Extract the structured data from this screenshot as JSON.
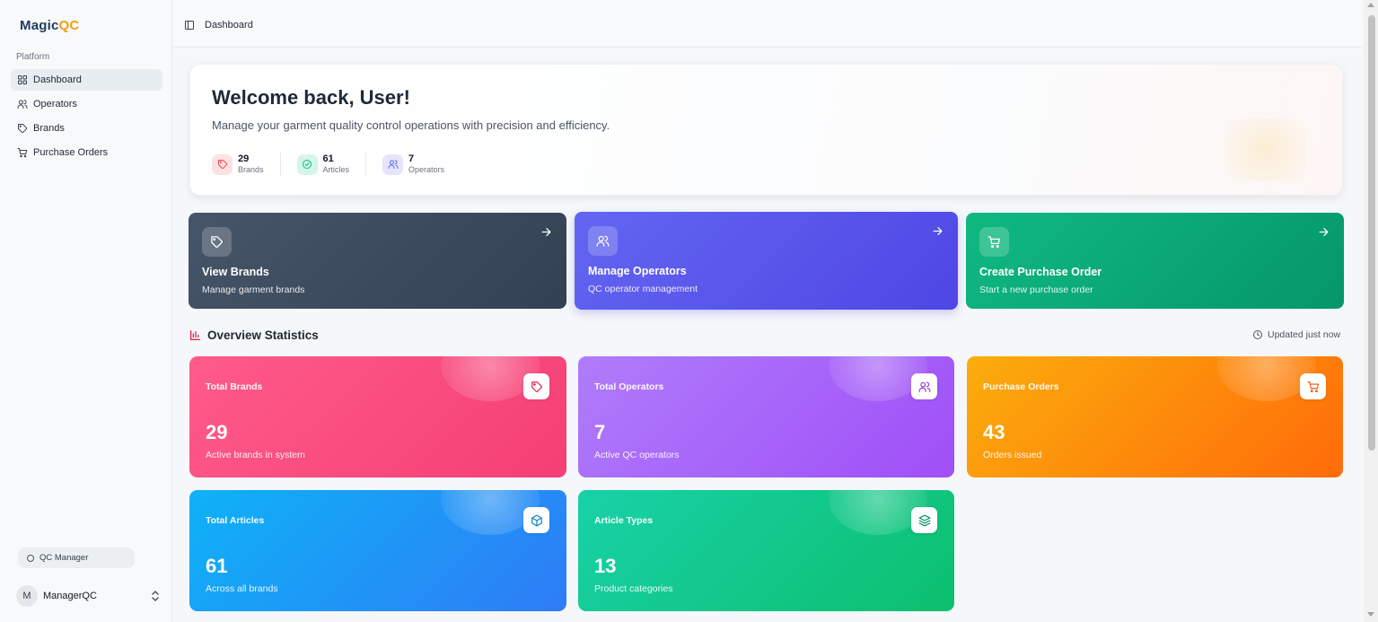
{
  "app": {
    "logo_part1": "Magic",
    "logo_part2": "QC"
  },
  "sidebar": {
    "section_label": "Platform",
    "items": [
      {
        "label": "Dashboard",
        "icon": "grid-icon",
        "active": true
      },
      {
        "label": "Operators",
        "icon": "users-icon"
      },
      {
        "label": "Brands",
        "icon": "tag-icon"
      },
      {
        "label": "Purchase Orders",
        "icon": "cart-icon"
      }
    ],
    "role_badge": "QC Manager",
    "user": {
      "initial": "M",
      "name": "ManagerQC"
    }
  },
  "header": {
    "breadcrumb": "Dashboard"
  },
  "welcome": {
    "title": "Welcome back, User!",
    "subtitle": "Manage your garment quality control operations with precision and efficiency.",
    "stats": [
      {
        "value": "29",
        "label": "Brands",
        "icon": "tag-icon",
        "color": "#ef4444",
        "bg": "#fde2e4"
      },
      {
        "value": "61",
        "label": "Articles",
        "icon": "check-circle-icon",
        "color": "#10b981",
        "bg": "#d6f5e8"
      },
      {
        "value": "7",
        "label": "Operators",
        "icon": "users-icon",
        "color": "#6366f1",
        "bg": "#e4e5fb"
      }
    ]
  },
  "actions": [
    {
      "title": "View Brands",
      "desc": "Manage garment brands",
      "icon": "tag-icon"
    },
    {
      "title": "Manage Operators",
      "desc": "QC operator management",
      "icon": "users-icon"
    },
    {
      "title": "Create Purchase Order",
      "desc": "Start a new purchase order",
      "icon": "cart-icon"
    }
  ],
  "overview": {
    "title": "Overview Statistics",
    "updated": "Updated just now"
  },
  "stat_cards": [
    {
      "title": "Total Brands",
      "value": "29",
      "desc": "Active brands in system",
      "icon": "tag-icon",
      "icon_color": "#e11d48"
    },
    {
      "title": "Total Operators",
      "value": "7",
      "desc": "Active QC operators",
      "icon": "users-icon",
      "icon_color": "#9333ea"
    },
    {
      "title": "Purchase Orders",
      "value": "43",
      "desc": "Orders issued",
      "icon": "cart-icon",
      "icon_color": "#ea580c"
    },
    {
      "title": "Total Articles",
      "value": "61",
      "desc": "Across all brands",
      "icon": "box-icon",
      "icon_color": "#0284c7"
    },
    {
      "title": "Article Types",
      "value": "13",
      "desc": "Product categories",
      "icon": "layers-icon",
      "icon_color": "#059669"
    }
  ]
}
